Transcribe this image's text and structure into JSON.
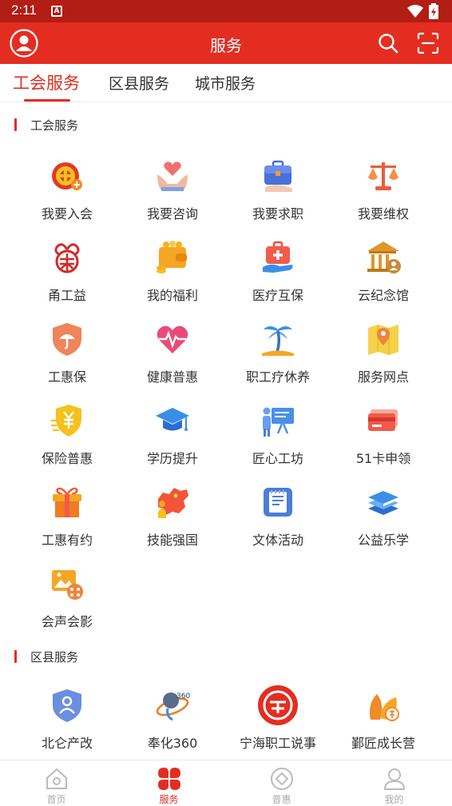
{
  "status_bar": {
    "time": "2:11",
    "notification": "A"
  },
  "header": {
    "title": "服务"
  },
  "tabs": [
    {
      "label": "工会服务",
      "active": true
    },
    {
      "label": "区县服务",
      "active": false
    },
    {
      "label": "城市服务",
      "active": false
    }
  ],
  "sections": {
    "union": {
      "title": "工会服务"
    },
    "district": {
      "title": "区县服务"
    }
  },
  "union_services": [
    {
      "label": "我要入会",
      "icon": "union-badge-icon"
    },
    {
      "label": "我要咨询",
      "icon": "heart-hands-icon"
    },
    {
      "label": "我要求职",
      "icon": "briefcase-icon"
    },
    {
      "label": "我要维权",
      "icon": "scales-icon"
    },
    {
      "label": "甬工益",
      "icon": "charity-logo-icon"
    },
    {
      "label": "我的福利",
      "icon": "wallet-coins-icon"
    },
    {
      "label": "医疗互保",
      "icon": "medical-kit-icon"
    },
    {
      "label": "云纪念馆",
      "icon": "memorial-hall-icon"
    },
    {
      "label": "工惠保",
      "icon": "umbrella-shield-icon"
    },
    {
      "label": "健康普惠",
      "icon": "heartbeat-icon"
    },
    {
      "label": "职工疗休养",
      "icon": "palm-tree-icon"
    },
    {
      "label": "服务网点",
      "icon": "map-pin-icon"
    },
    {
      "label": "保险普惠",
      "icon": "yen-shield-icon"
    },
    {
      "label": "学历提升",
      "icon": "graduation-cap-icon"
    },
    {
      "label": "匠心工坊",
      "icon": "workshop-board-icon"
    },
    {
      "label": "51卡申领",
      "icon": "bank-card-icon"
    },
    {
      "label": "工惠有约",
      "icon": "gift-box-icon"
    },
    {
      "label": "技能强国",
      "icon": "china-map-icon"
    },
    {
      "label": "文体活动",
      "icon": "notepad-icon"
    },
    {
      "label": "公益乐学",
      "icon": "books-icon"
    },
    {
      "label": "会声会影",
      "icon": "film-photo-icon"
    }
  ],
  "district_services": [
    {
      "label": "北仑产改",
      "icon": "person-shield-icon"
    },
    {
      "label": "奉化360",
      "icon": "fenghua-360-icon"
    },
    {
      "label": "宁海职工说事",
      "icon": "ninghai-logo-icon"
    },
    {
      "label": "鄞匠成长营",
      "icon": "leaf-growth-icon"
    }
  ],
  "bottom_nav": [
    {
      "label": "首页",
      "icon": "home-icon",
      "active": false
    },
    {
      "label": "服务",
      "icon": "clover-icon",
      "active": true
    },
    {
      "label": "普惠",
      "icon": "diamond-icon",
      "active": false
    },
    {
      "label": "我的",
      "icon": "profile-icon",
      "active": false
    }
  ],
  "colors": {
    "primary": "#e42d21",
    "status_bar": "#b21d14",
    "text": "#333333",
    "inactive": "#aaaaaa"
  }
}
